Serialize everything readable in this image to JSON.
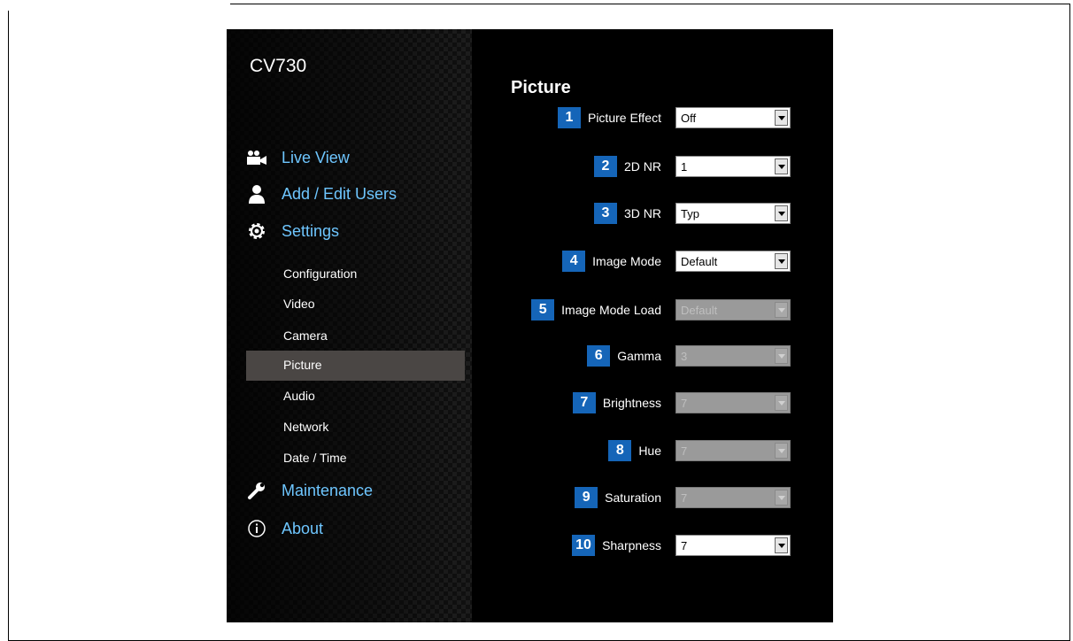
{
  "app": {
    "title": "CV730"
  },
  "nav": {
    "main": [
      {
        "label": "Live View",
        "icon": "video-camera-icon"
      },
      {
        "label": "Add / Edit Users",
        "icon": "user-icon"
      },
      {
        "label": "Settings",
        "icon": "gear-icon"
      },
      {
        "label": "Maintenance",
        "icon": "wrench-icon"
      },
      {
        "label": "About",
        "icon": "info-icon"
      }
    ],
    "sub": [
      "Configuration",
      "Video",
      "Camera",
      "Picture",
      "Audio",
      "Network",
      "Date / Time"
    ],
    "active_sub": "Picture"
  },
  "page": {
    "title": "Picture",
    "fields": [
      {
        "num": "1",
        "label": "Picture Effect",
        "value": "Off",
        "enabled": true
      },
      {
        "num": "2",
        "label": "2D NR",
        "value": "1",
        "enabled": true
      },
      {
        "num": "3",
        "label": "3D NR",
        "value": "Typ",
        "enabled": true
      },
      {
        "num": "4",
        "label": "Image Mode",
        "value": "Default",
        "enabled": true
      },
      {
        "num": "5",
        "label": "Image Mode Load",
        "value": "Default",
        "enabled": false
      },
      {
        "num": "6",
        "label": "Gamma",
        "value": "3",
        "enabled": false
      },
      {
        "num": "7",
        "label": "Brightness",
        "value": "7",
        "enabled": false
      },
      {
        "num": "8",
        "label": "Hue",
        "value": "7",
        "enabled": false
      },
      {
        "num": "9",
        "label": "Saturation",
        "value": "7",
        "enabled": false
      },
      {
        "num": "10",
        "label": "Sharpness",
        "value": "7",
        "enabled": true
      }
    ]
  },
  "colors": {
    "accent": "#6ec6ff",
    "badge": "#1565b8",
    "active_bg": "#4a4644"
  }
}
